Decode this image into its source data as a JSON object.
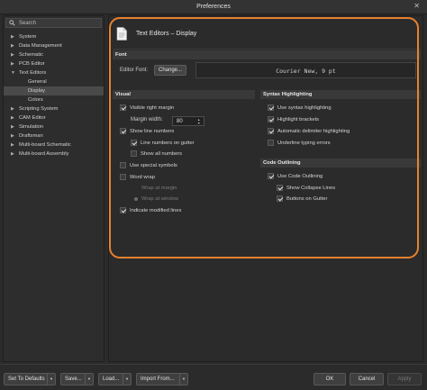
{
  "window": {
    "title": "Preferences",
    "close_glyph": "✕"
  },
  "search": {
    "placeholder": "Search",
    "icon": "search-icon"
  },
  "tree": [
    {
      "label": "System",
      "expanded": false
    },
    {
      "label": "Data Management",
      "expanded": false
    },
    {
      "label": "Schematic",
      "expanded": false
    },
    {
      "label": "PCB Editor",
      "expanded": false
    },
    {
      "label": "Text Editors",
      "expanded": true
    },
    {
      "label": "General",
      "child": true
    },
    {
      "label": "Display",
      "child": true,
      "selected": true
    },
    {
      "label": "Colors",
      "child": true
    },
    {
      "label": "Scripting System",
      "expanded": false
    },
    {
      "label": "CAM Editor",
      "expanded": false
    },
    {
      "label": "Simulation",
      "expanded": false
    },
    {
      "label": "Draftsman",
      "expanded": false
    },
    {
      "label": "Multi-board Schematic",
      "expanded": false
    },
    {
      "label": "Multi-board Assembly",
      "expanded": false
    }
  ],
  "page": {
    "title": "Text Editors – Display",
    "icon": "document-icon"
  },
  "font_section": {
    "header": "Font",
    "editor_font_label": "Editor Font:",
    "change_button": "Change...",
    "font_preview": "Courier New, 9 pt"
  },
  "visual": {
    "header": "Visual",
    "visible_right_margin": {
      "label": "Visible right margin",
      "checked": true
    },
    "margin_width": {
      "label": "Margin width:",
      "value": "80"
    },
    "show_line_numbers": {
      "label": "Show line numbers",
      "checked": true
    },
    "line_numbers_on_gutter": {
      "label": "Line numbers on gutter",
      "checked": true
    },
    "show_all_numbers": {
      "label": "Show all numbers",
      "checked": false
    },
    "use_special_symbols": {
      "label": "Use special symbols",
      "checked": false
    },
    "word_wrap": {
      "label": "Word wrap",
      "checked": false
    },
    "wrap_at_margin": {
      "label": "Wrap at margin",
      "enabled": false
    },
    "wrap_at_window": {
      "label": "Wrap at window",
      "enabled": false
    },
    "indicate_modified_lines": {
      "label": "Indicate modified lines",
      "checked": true
    }
  },
  "syntax": {
    "header": "Syntax Highlighting",
    "use_syntax_highlighting": {
      "label": "Use syntax highlighting",
      "checked": true
    },
    "highlight_brackets": {
      "label": "Highlight brackets",
      "checked": true
    },
    "automatic_delimiter_highlighting": {
      "label": "Automatic delimiter highlighting",
      "checked": true
    },
    "underline_typing_errors": {
      "label": "Underline typing errors",
      "checked": false
    }
  },
  "outlining": {
    "header": "Code Outlining",
    "use_code_outlining": {
      "label": "Use Code Outlining",
      "checked": true
    },
    "show_collapse_lines": {
      "label": "Show Collapse Lines",
      "checked": true
    },
    "buttons_on_gutter": {
      "label": "Buttons on Gutter",
      "checked": true
    }
  },
  "footer": {
    "set_to_defaults": "Set To Defaults",
    "save": "Save...",
    "load": "Load...",
    "import_from": "Import From...",
    "ok": "OK",
    "cancel": "Cancel",
    "apply": "Apply"
  },
  "colors": {
    "highlight_outline": "#e6822e"
  }
}
